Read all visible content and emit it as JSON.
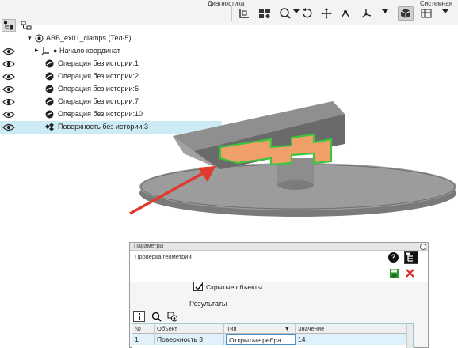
{
  "toolbar": {
    "group_diagnostics": "Диагностика",
    "group_system": "Системная"
  },
  "tree": {
    "root": "ABB_ex01_clamps (Тел-5)",
    "items": [
      {
        "label": "Начало координат"
      },
      {
        "label": "Операция без истории:1"
      },
      {
        "label": "Операция без истории:2"
      },
      {
        "label": "Операция без истории:6"
      },
      {
        "label": "Операция без истории:7"
      },
      {
        "label": "Операция без истории:10"
      },
      {
        "label": "Поверхность без истории:3"
      }
    ]
  },
  "dialog": {
    "title": "Параметры",
    "subtitle": "Проверка геометрии",
    "checkbox_label": "Скрытые объекты",
    "checkbox_checked": true,
    "results_label": "Результаты",
    "grid": {
      "headers": [
        "№",
        "Объект",
        "Тип",
        "Значение"
      ],
      "rows": [
        {
          "num": "1",
          "object": "Поверхность 3",
          "type": "Открытые ребра",
          "value": "14"
        }
      ]
    }
  },
  "colors": {
    "selection": "#cdebf5",
    "highlight_face": "#f2a06a",
    "highlight_edge": "#3ec43e",
    "arrow": "#e03a2e"
  }
}
